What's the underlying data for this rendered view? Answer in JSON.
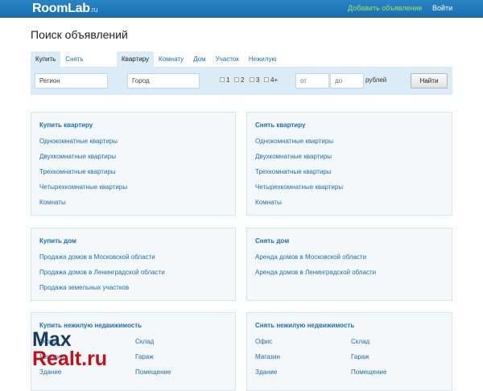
{
  "header": {
    "logo": "RoomLab",
    "logo_suffix": ".ru",
    "add_listing": "Добавить объявление",
    "login": "Войти"
  },
  "page_title": "Поиск объявлений",
  "deal_tabs": [
    "Купить",
    "Снять"
  ],
  "type_tabs": [
    "Квартиру",
    "Комнату",
    "Дом",
    "Участок",
    "Нежилую"
  ],
  "search": {
    "region_value": "Регион",
    "city_value": "Город",
    "rooms": [
      "1",
      "2",
      "3",
      "4+"
    ],
    "price_from_placeholder": "от",
    "price_to_placeholder": "до",
    "currency": "рублей",
    "find_button": "Найти"
  },
  "sections": {
    "buy_flat": {
      "title": "Купить квартиру",
      "links": [
        "Однокомнатные квартиры",
        "Двухкомнатные квартиры",
        "Трехкомнатные квартиры",
        "Четырехкомнатные квартиры",
        "Комнаты"
      ]
    },
    "rent_flat": {
      "title": "Снять квартиру",
      "links": [
        "Однокомнатные квартиры",
        "Двухкомнатные квартиры",
        "Трехкомнатные квартиры",
        "Четырехкомнатные квартиры",
        "Комнаты"
      ]
    },
    "buy_house": {
      "title": "Купить дом",
      "links": [
        "Продажа домов в Московской области",
        "Продажа домов в Ленинградской области",
        "Продажа земельных участков"
      ]
    },
    "rent_house": {
      "title": "Снять дом",
      "links": [
        "Аренда домов в Московской области",
        "Аренда домов в Ленинградской области"
      ]
    },
    "buy_commercial": {
      "title": "Купить нежилую недвижимость",
      "links": [
        "Офис",
        "Склад",
        "Магазин",
        "Гараж",
        "Здание",
        "Помещение"
      ]
    },
    "rent_commercial": {
      "title": "Снять нежилую недвижимость",
      "links": [
        "Офис",
        "Склад",
        "Магазин",
        "Гараж",
        "Здание",
        "Помещение"
      ]
    }
  },
  "watermark": {
    "line1": "Max",
    "line2": "Realt.ru"
  }
}
